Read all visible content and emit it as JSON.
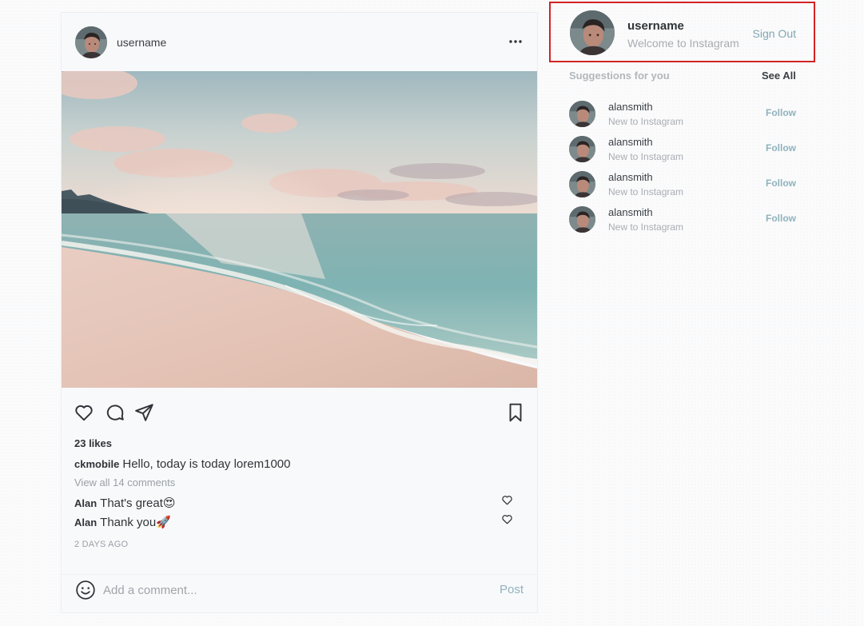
{
  "post": {
    "username": "username",
    "image_alt": "beach sunset",
    "likes": "23 likes",
    "caption_user": "ckmobile",
    "caption_text": "Hello, today is today lorem1000",
    "view_comments": "View all 14 comments",
    "comments": [
      {
        "user": "Alan",
        "text": "That's great😍"
      },
      {
        "user": "Alan",
        "text": "Thank you🚀"
      }
    ],
    "timestamp": "2 DAYS AGO",
    "comment_placeholder": "Add a comment...",
    "post_label": "Post"
  },
  "sidebar": {
    "profile": {
      "username": "username",
      "subtitle": "Welcome to Instagram",
      "sign_out": "Sign Out"
    },
    "suggestions_title": "Suggestions for you",
    "see_all": "See All",
    "suggestions": [
      {
        "name": "alansmith",
        "sub": "New to Instagram",
        "action": "Follow"
      },
      {
        "name": "alansmith",
        "sub": "New to Instagram",
        "action": "Follow"
      },
      {
        "name": "alansmith",
        "sub": "New to Instagram",
        "action": "Follow"
      },
      {
        "name": "alansmith",
        "sub": "New to Instagram",
        "action": "Follow"
      }
    ]
  },
  "colors": {
    "accent_link": "#8fb3bd",
    "highlight_border": "#d32323"
  },
  "icons": {
    "like": "heart-icon",
    "comment": "comment-icon",
    "share": "send-icon",
    "save": "bookmark-icon",
    "more": "more-horizontal-icon",
    "emoji": "emoji-icon"
  }
}
